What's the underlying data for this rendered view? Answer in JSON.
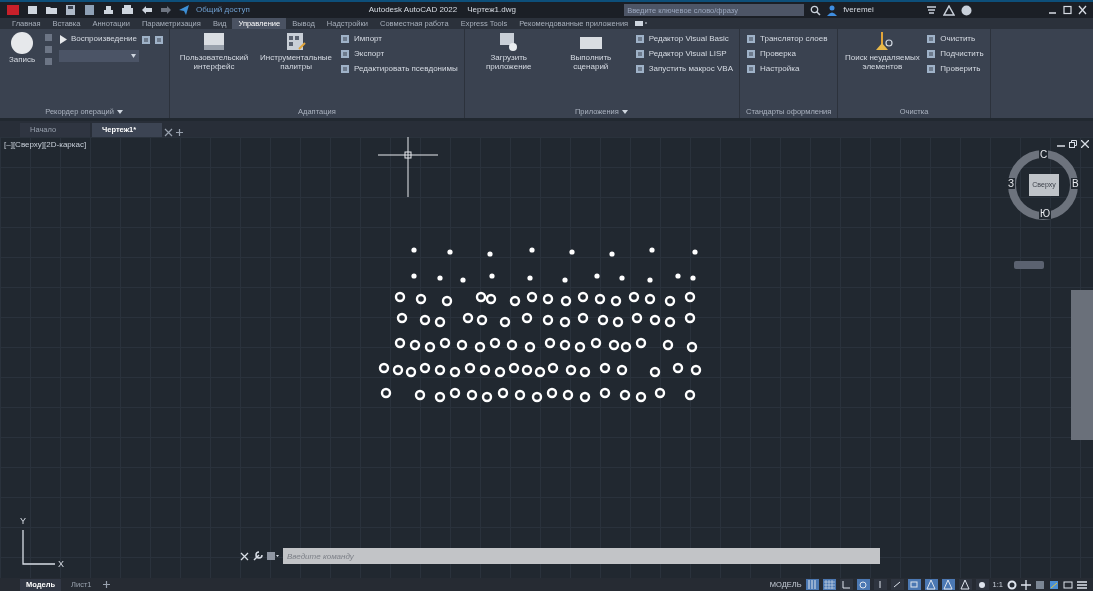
{
  "title_bar": {
    "share": "Общий доступ",
    "app_title": "Autodesk AutoCAD 2022",
    "file_name": "Чертеж1.dwg",
    "search_placeholder": "Введите ключевое слово/фразу",
    "user": "fveremei"
  },
  "ribbon_tabs": [
    {
      "label": "Главная",
      "selected": false
    },
    {
      "label": "Вставка",
      "selected": false
    },
    {
      "label": "Аннотации",
      "selected": false
    },
    {
      "label": "Параметризация",
      "selected": false
    },
    {
      "label": "Вид",
      "selected": false
    },
    {
      "label": "Управление",
      "selected": true
    },
    {
      "label": "Вывод",
      "selected": false
    },
    {
      "label": "Надстройки",
      "selected": false
    },
    {
      "label": "Совместная работа",
      "selected": false
    },
    {
      "label": "Express Tools",
      "selected": false
    },
    {
      "label": "Рекомендованные приложения",
      "selected": false
    }
  ],
  "ribbon_panels": [
    {
      "title": "Рекордер операций",
      "menu": true,
      "items": [
        {
          "kind": "record",
          "label": "Запись"
        },
        {
          "kind": "play",
          "label": "Воспроизведение"
        }
      ]
    },
    {
      "title": "Адаптация",
      "menu": false,
      "items": [
        {
          "kind": "large",
          "label": "Пользовательский интерфейс"
        },
        {
          "kind": "large",
          "label": "Инструментальные палитры"
        },
        {
          "kind": "stack",
          "labels": [
            "Импорт",
            "Экспорт",
            "Редактировать псевдонимы"
          ]
        }
      ]
    },
    {
      "title": "Приложения",
      "menu": true,
      "items": [
        {
          "kind": "large",
          "label": "Загрузить приложение"
        },
        {
          "kind": "large",
          "label": "Выполнить сценарий"
        },
        {
          "kind": "stack",
          "labels": [
            "Редактор Visual Basic",
            "Редактор Visual LISP",
            "Запустить макрос VBA"
          ]
        }
      ]
    },
    {
      "title": "Стандарты оформления",
      "menu": false,
      "items": [
        {
          "kind": "stack",
          "labels": [
            "Транслятор  слоев",
            "Проверка",
            "Настройка"
          ]
        }
      ]
    },
    {
      "title": "Очистка",
      "menu": false,
      "items": [
        {
          "kind": "large",
          "label": "Поиск неудаляемых элементов"
        },
        {
          "kind": "stack",
          "labels": [
            "Очистить",
            "Подчистить",
            "Проверить"
          ]
        }
      ]
    }
  ],
  "file_tabs": [
    {
      "label": "Начало",
      "selected": false
    },
    {
      "label": "Чертеж1*",
      "selected": true
    }
  ],
  "viewport": {
    "label": "[–][Сверху][2D-каркас]"
  },
  "view_cube": {
    "north": "С",
    "east": "В",
    "south": "Ю",
    "west": "З",
    "face": "Сверху"
  },
  "ucs": {
    "y": "Y",
    "x": "X"
  },
  "command_line": {
    "placeholder": "Введите команду"
  },
  "layout_tabs": [
    {
      "label": "Модель",
      "selected": true
    },
    {
      "label": "Лист1",
      "selected": false
    }
  ],
  "status_bar": {
    "space": "МОДЕЛЬ",
    "scale": "1:1",
    "toggles": [
      {
        "on": true
      },
      {
        "on": true
      },
      {
        "on": false
      },
      {
        "on": true
      },
      {
        "on": false
      },
      {
        "on": false
      },
      {
        "on": true
      },
      {
        "on": true
      },
      {
        "on": true
      },
      {
        "on": false
      },
      {
        "on": false
      }
    ]
  }
}
